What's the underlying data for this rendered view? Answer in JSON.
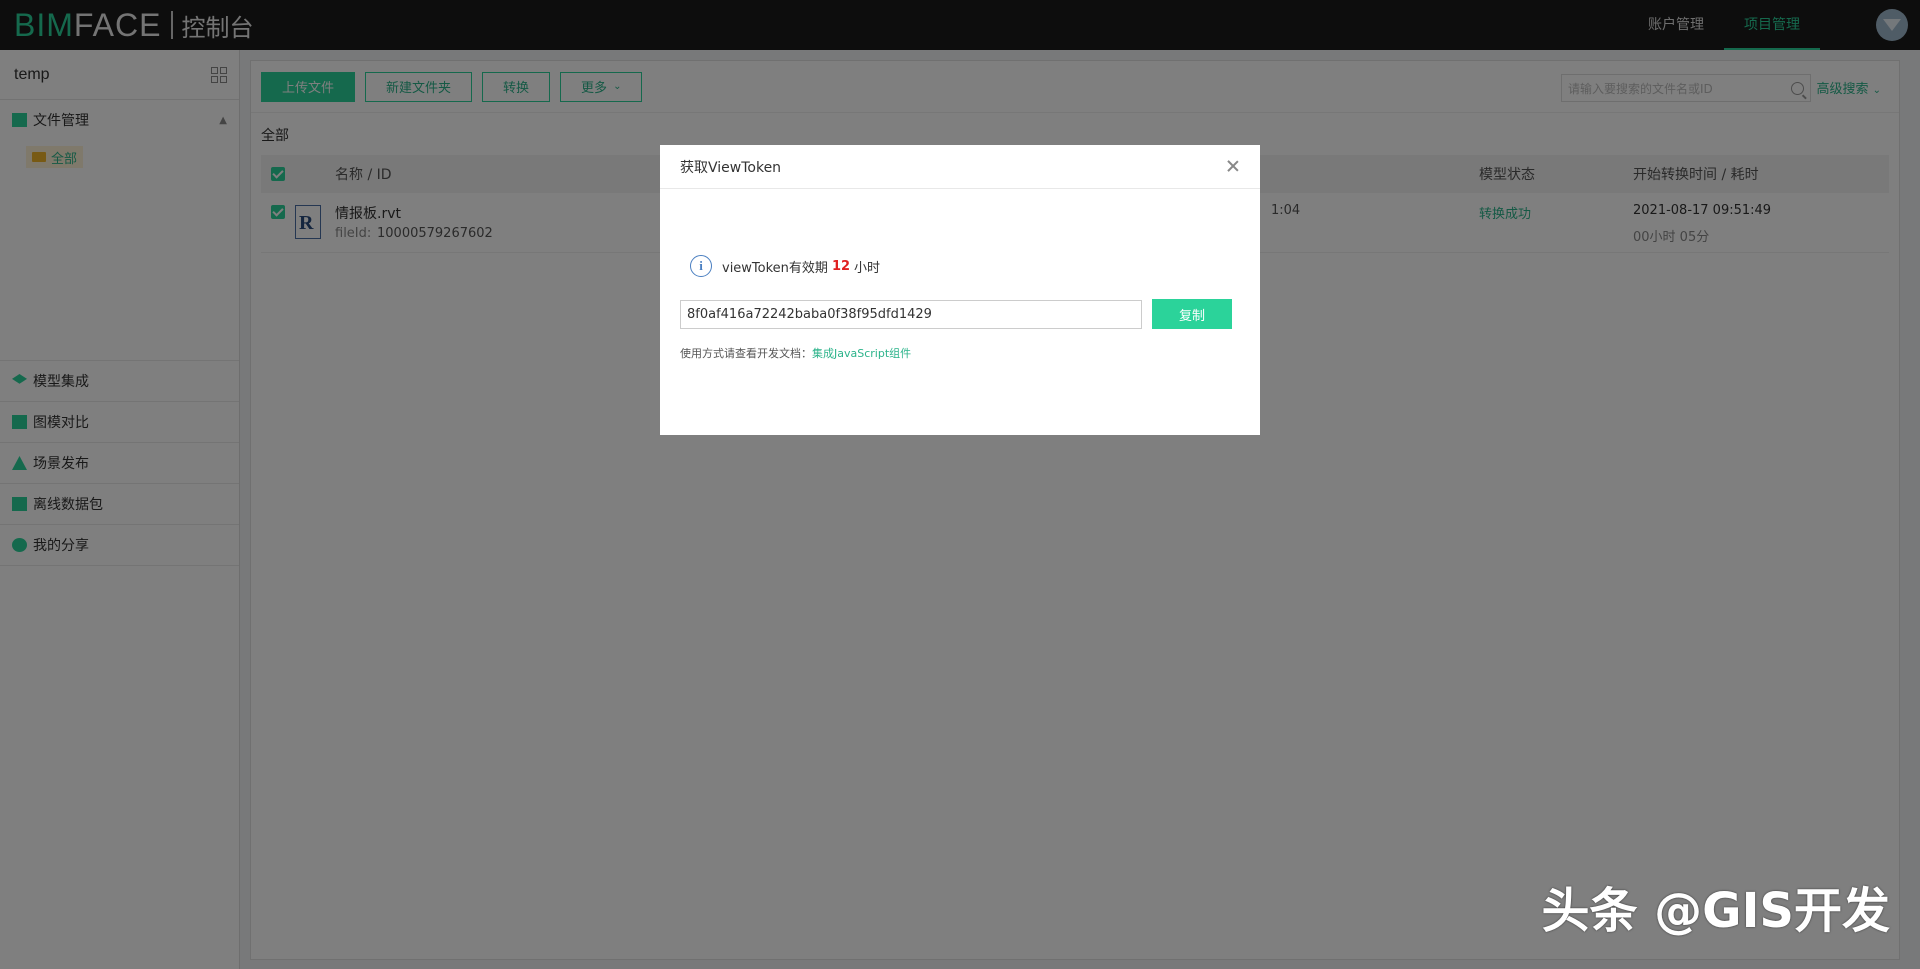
{
  "header": {
    "logo_bim": "BIM",
    "logo_face": "FACE",
    "logo_console": "控制台",
    "nav": [
      {
        "label": "账户管理",
        "active": false
      },
      {
        "label": "项目管理",
        "active": true
      }
    ]
  },
  "sidebar": {
    "project_name": "temp",
    "file_management": "文件管理",
    "sub_all": "全部",
    "items": [
      {
        "label": "模型集成",
        "icon": "layers-icon"
      },
      {
        "label": "图模对比",
        "icon": "compare-icon"
      },
      {
        "label": "场景发布",
        "icon": "scene-icon"
      },
      {
        "label": "离线数据包",
        "icon": "package-icon"
      },
      {
        "label": "我的分享",
        "icon": "share-icon"
      }
    ]
  },
  "toolbar": {
    "upload": "上传文件",
    "new_folder": "新建文件夹",
    "convert": "转换",
    "more": "更多",
    "search_placeholder": "请输入要搜索的文件名或ID",
    "advanced_search": "高级搜索"
  },
  "breadcrumb": "全部",
  "table": {
    "headers": {
      "name": "名称 / ID",
      "status": "模型状态",
      "start_time": "开始转换时间 / 耗时"
    },
    "rows": [
      {
        "file_name": "情报板.rvt",
        "file_id_label": "fileId:",
        "file_id": "10000579267602",
        "partial_time": "1:04",
        "status": "转换成功",
        "start_time": "2021-08-17 09:51:49",
        "duration": "00小时 05分"
      }
    ]
  },
  "modal": {
    "title": "获取ViewToken",
    "validity_prefix": "viewToken有效期",
    "validity_hours": "12",
    "validity_suffix": "小时",
    "token": "8f0af416a72242baba0f38f95dfd1429",
    "copy": "复制",
    "usage_prefix": "使用方式请查看开发文档：",
    "usage_link": "集成JavaScript组件"
  },
  "watermark": "头条 @GIS开发",
  "colors": {
    "accent": "#2bd39a",
    "topbar": "#1b1b1b",
    "highlight_red": "#e02020"
  }
}
